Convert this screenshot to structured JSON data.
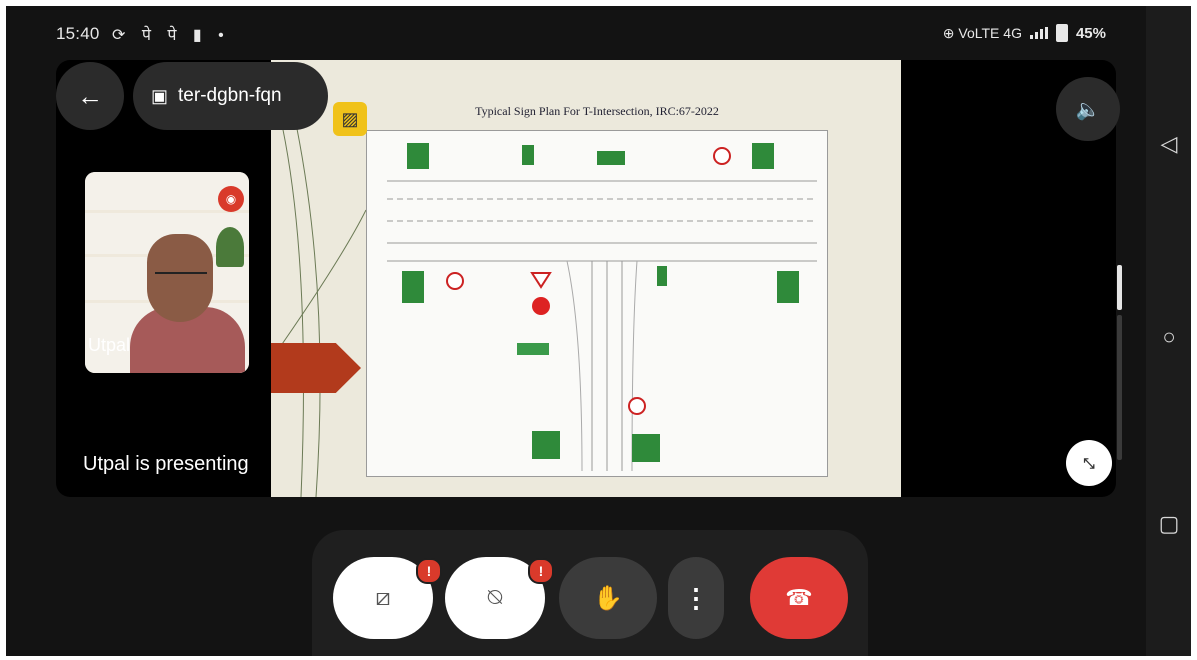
{
  "status_bar": {
    "time": "15:40",
    "left_icons": "⟳ पे पे ▮ •",
    "network_info": "⊕ VoLTE 4G",
    "battery": "45%"
  },
  "meeting": {
    "code": "ter-dgbn-fqn",
    "participant_name": "Utpal",
    "presenting_text": "Utpal is presenting"
  },
  "slide": {
    "title": "Typical Sign Plan For T-Intersection, IRC:67-2022"
  },
  "controls": {
    "camera_alert": "!",
    "mic_alert": "!",
    "more": "⋮"
  },
  "icons": {
    "back": "back-arrow-icon",
    "calendar": "calendar-icon",
    "volume": "volume-icon",
    "collapse": "collapse-icon",
    "camera_off": "camera-off-icon",
    "mic_off": "mic-off-icon",
    "hand": "raise-hand-icon",
    "end_call": "end-call-icon"
  },
  "colors": {
    "end_call": "#e03a36",
    "alert": "#d93a2b",
    "extension": "#f0c21a"
  }
}
